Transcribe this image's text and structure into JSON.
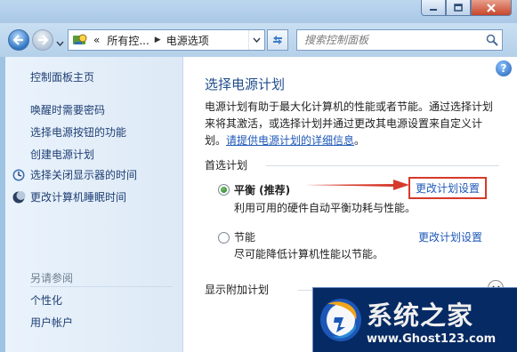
{
  "window": {
    "controls": [
      "minimize-icon",
      "maximize-icon",
      "close-icon"
    ]
  },
  "address": {
    "prefix": "«",
    "crumbs": [
      "所有控...",
      "电源选项"
    ],
    "icon": "control-panel-icon"
  },
  "search": {
    "placeholder": "搜索控制面板"
  },
  "sidebar": {
    "links": [
      {
        "label": "控制面板主页"
      },
      {
        "label": "唤醒时需要密码"
      },
      {
        "label": "选择电源按钮的功能"
      },
      {
        "label": "创建电源计划"
      },
      {
        "label": "选择关闭显示器的时间",
        "icon": "monitor-clock-icon"
      },
      {
        "label": "更改计算机睡眠时间",
        "icon": "moon-icon"
      }
    ],
    "see_also_title": "另请参阅",
    "see_also": [
      {
        "label": "个性化"
      },
      {
        "label": "用户帐户"
      }
    ]
  },
  "main": {
    "help": "?",
    "title": "选择电源计划",
    "desc_line1": "电源计划有助于最大化计算机的性能或者节能。通过选择计划",
    "desc_line2": "来将其激活，或选择计划并通过更改其电源设置来自定义计",
    "desc_line3_prefix": "划。",
    "desc_link": "请提供电源计划的详细信息",
    "desc_line3_suffix": "。",
    "preferred_title": "首选计划",
    "plans": [
      {
        "name": "平衡 (推荐)",
        "desc": "利用可用的硬件自动平衡功耗与性能。",
        "link": "更改计划设置",
        "selected": true
      },
      {
        "name": "节能",
        "desc": "尽可能降低计算机性能以节能。",
        "link": "更改计划设置",
        "selected": false
      }
    ],
    "extra_title": "显示附加计划"
  },
  "annotation": {
    "color": "#d63a2c"
  },
  "watermark": {
    "title": "系统之家",
    "url": "www.Ghost123.com"
  }
}
